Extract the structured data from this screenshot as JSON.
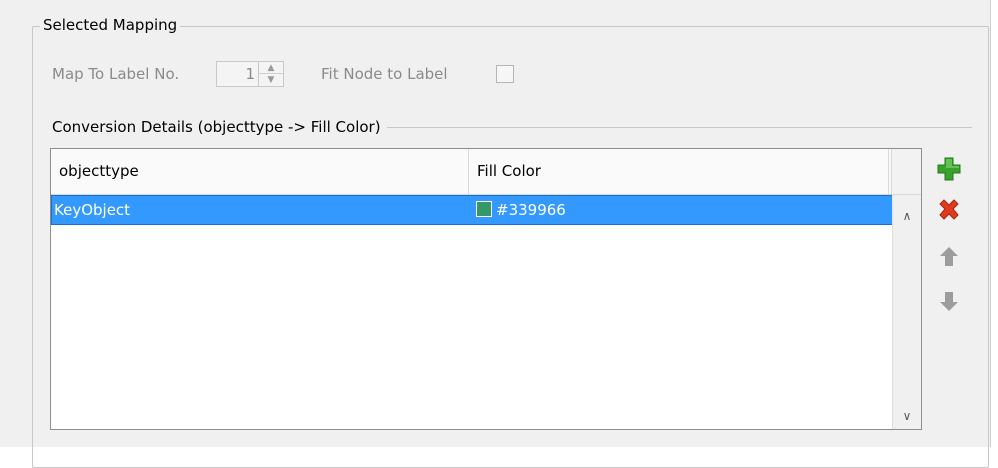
{
  "group": {
    "title": "Selected Mapping"
  },
  "map_to_label": {
    "label": "Map To Label No.",
    "value": "1"
  },
  "fit_node": {
    "label": "Fit Node to Label",
    "checked": false
  },
  "conversion": {
    "title": "Conversion Details (objecttype -> Fill Color)",
    "columns": [
      "objecttype",
      "Fill Color"
    ],
    "rows": [
      {
        "objecttype": "KeyObject",
        "fill_color": "#339966"
      }
    ]
  },
  "icons": {
    "spin_up": "▲",
    "spin_down": "▼",
    "scroll_up": "∧",
    "scroll_down": "∨",
    "add": "add-icon",
    "remove": "remove-icon",
    "move_up": "arrow-up-icon",
    "move_down": "arrow-down-icon"
  },
  "colors": {
    "selection": "#3399ff",
    "swatch": "#339966",
    "add_green": "#3aa12c",
    "remove_red": "#e03a1c",
    "arrow_gray": "#9c9c9c"
  }
}
